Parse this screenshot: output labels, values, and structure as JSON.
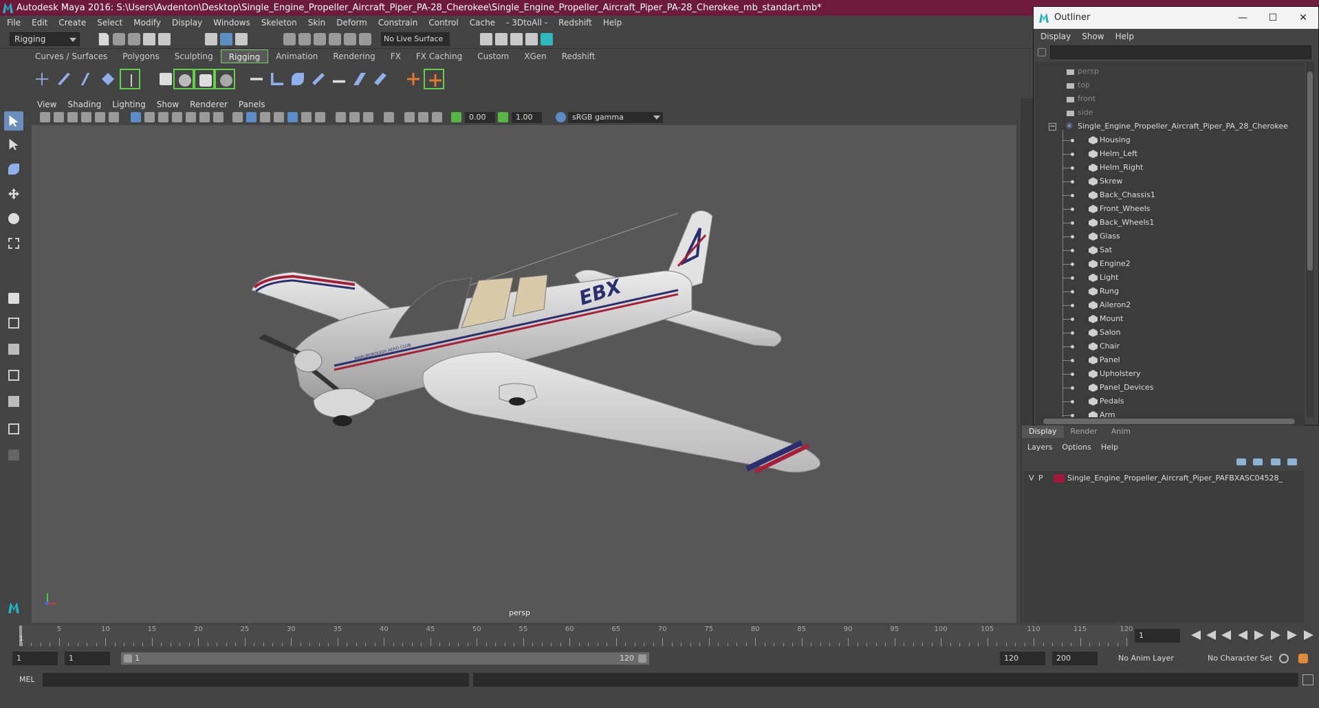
{
  "window": {
    "title": "Autodesk Maya 2016: S:\\Users\\Avdenton\\Desktop\\Single_Engine_Propeller_Aircraft_Piper_PA-28_Cherokee\\Single_Engine_Propeller_Aircraft_Piper_PA-28_Cherokee_mb_standart.mb*"
  },
  "menubar": [
    "File",
    "Edit",
    "Create",
    "Select",
    "Modify",
    "Display",
    "Windows",
    "Skeleton",
    "Skin",
    "Deform",
    "Constrain",
    "Control",
    "Cache",
    "- 3DtoAll -",
    "Redshift",
    "Help"
  ],
  "statusline": {
    "mode": "Rigging",
    "live_surface": "No Live Surface"
  },
  "shelf": {
    "tabs": [
      "Curves / Surfaces",
      "Polygons",
      "Sculpting",
      "Rigging",
      "Animation",
      "Rendering",
      "FX",
      "FX Caching",
      "Custom",
      "XGen",
      "Redshift"
    ],
    "active_tab": "Rigging"
  },
  "viewport": {
    "menus": [
      "View",
      "Shading",
      "Lighting",
      "Show",
      "Renderer",
      "Panels"
    ],
    "exposure": "0.00",
    "gamma": "1.00",
    "color_space": "sRGB gamma",
    "camera_label": "persp",
    "plane_registration": "EBX",
    "plane_nose_text": "MARLBOROUGH AERO CLUB"
  },
  "outliner": {
    "title": "Outliner",
    "menus": [
      "Display",
      "Show",
      "Help"
    ],
    "cameras": [
      "persp",
      "top",
      "front",
      "side"
    ],
    "root": "Single_Engine_Propeller_Aircraft_Piper_PA_28_Cherokee",
    "children": [
      "Housing",
      "Helm_Left",
      "Helm_Right",
      "Skrew",
      "Back_Chassis1",
      "Front_Wheels",
      "Back_Wheels1",
      "Glass",
      "Sat",
      "Engine2",
      "Light",
      "Rung",
      "Aileron2",
      "Mount",
      "Salon",
      "Chair",
      "Panel",
      "Upholstery",
      "Panel_Devices",
      "Pedals",
      "Arm"
    ],
    "window_buttons": {
      "minimize": "—",
      "maximize": "☐",
      "close": "✕"
    }
  },
  "layer_editor": {
    "tabs": [
      "Display",
      "Render",
      "Anim"
    ],
    "active_tab": "Display",
    "menus": [
      "Layers",
      "Options",
      "Help"
    ],
    "layer": {
      "v": "V",
      "p": "P",
      "name": "Single_Engine_Propeller_Aircraft_Piper_PAFBXASC04528_",
      "color": "#a2183a"
    }
  },
  "timeslider": {
    "ticks": [
      "5",
      "10",
      "15",
      "20",
      "25",
      "30",
      "35",
      "40",
      "45",
      "50",
      "55",
      "60",
      "65",
      "70",
      "75",
      "80",
      "85",
      "90",
      "95",
      "100",
      "105",
      "110",
      "115",
      "120"
    ],
    "start_marker": "1",
    "current_frame": "1"
  },
  "rangeslider": {
    "start": "1",
    "playback_start": "1",
    "bar_start": "1",
    "bar_end": "120",
    "playback_end": "120",
    "end": "200",
    "anim_layer": "No Anim Layer",
    "character_set": "No Character Set"
  },
  "cmdline": {
    "label": "MEL"
  },
  "colors": {
    "title_bar": "#6e1a3c",
    "accent_green": "#64d049",
    "maya_teal": "#1bb7c4"
  }
}
